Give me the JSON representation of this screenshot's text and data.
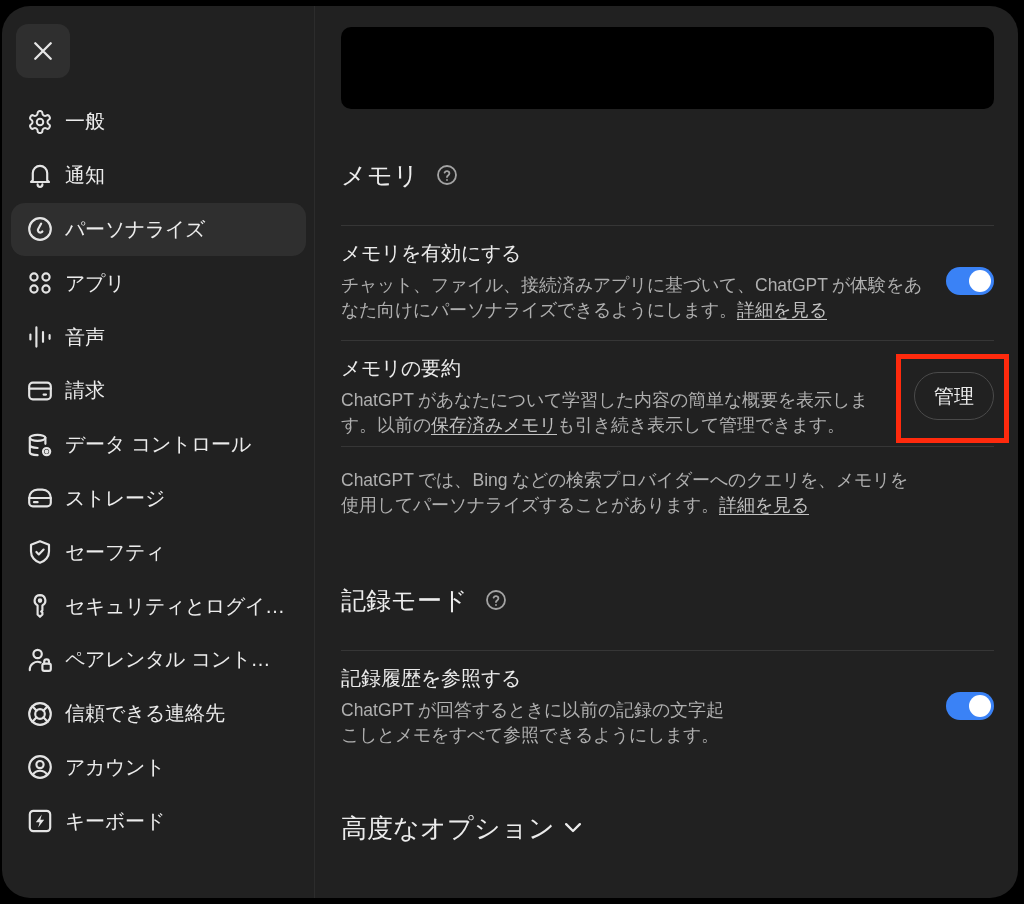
{
  "sidebar": {
    "items": [
      {
        "label": "一般",
        "selected": false
      },
      {
        "label": "通知",
        "selected": false
      },
      {
        "label": "パーソナライズ",
        "selected": true
      },
      {
        "label": "アプリ",
        "selected": false
      },
      {
        "label": "音声",
        "selected": false
      },
      {
        "label": "請求",
        "selected": false
      },
      {
        "label": "データ コントロール",
        "selected": false
      },
      {
        "label": "ストレージ",
        "selected": false
      },
      {
        "label": "セーフティ",
        "selected": false
      },
      {
        "label": "セキュリティとログイ…",
        "selected": false
      },
      {
        "label": "ペアレンタル コント…",
        "selected": false
      },
      {
        "label": "信頼できる連絡先",
        "selected": false
      },
      {
        "label": "アカウント",
        "selected": false
      },
      {
        "label": "キーボード",
        "selected": false
      }
    ]
  },
  "content": {
    "sections": [
      {
        "title": "メモリ",
        "rows": [
          {
            "kind": "toggle",
            "title": "メモリを有効にする",
            "description": [
              {
                "kind": "text",
                "text": "チャット、ファイル、接続済みアプリに基づいて、ChatGPT が体験をあなた向けにパーソナライズできるようにします。"
              },
              {
                "kind": "link",
                "text": "詳細を見る"
              }
            ],
            "on": true
          },
          {
            "kind": "button",
            "title": "メモリの要約",
            "description": [
              {
                "kind": "text",
                "text": "ChatGPT があなたについて学習した内容の簡単な概要を表示します。以前の"
              },
              {
                "kind": "link",
                "text": "保存済みメモリ"
              },
              {
                "kind": "text",
                "text": "も引き続き表示して管理できます。"
              }
            ],
            "button": {
              "label": "管理",
              "highlighted": true
            }
          },
          {
            "kind": "note",
            "description": [
              {
                "kind": "text",
                "text": "ChatGPT では、Bing などの検索プロバイダーへのクエリを、メモリを使用してパーソナライズすることがあります。"
              },
              {
                "kind": "link",
                "text": "詳細を見る"
              }
            ]
          }
        ]
      },
      {
        "title": "記録モード",
        "rows": [
          {
            "kind": "toggle",
            "title": "記録履歴を参照する",
            "description": [
              {
                "kind": "text",
                "text": "ChatGPT が回答するときに以前の記録の文字起こしとメモをすべて参照できるようにします。"
              }
            ],
            "on": true
          }
        ]
      }
    ],
    "advanced": {
      "label": "高度なオプション",
      "expanded": false
    }
  }
}
